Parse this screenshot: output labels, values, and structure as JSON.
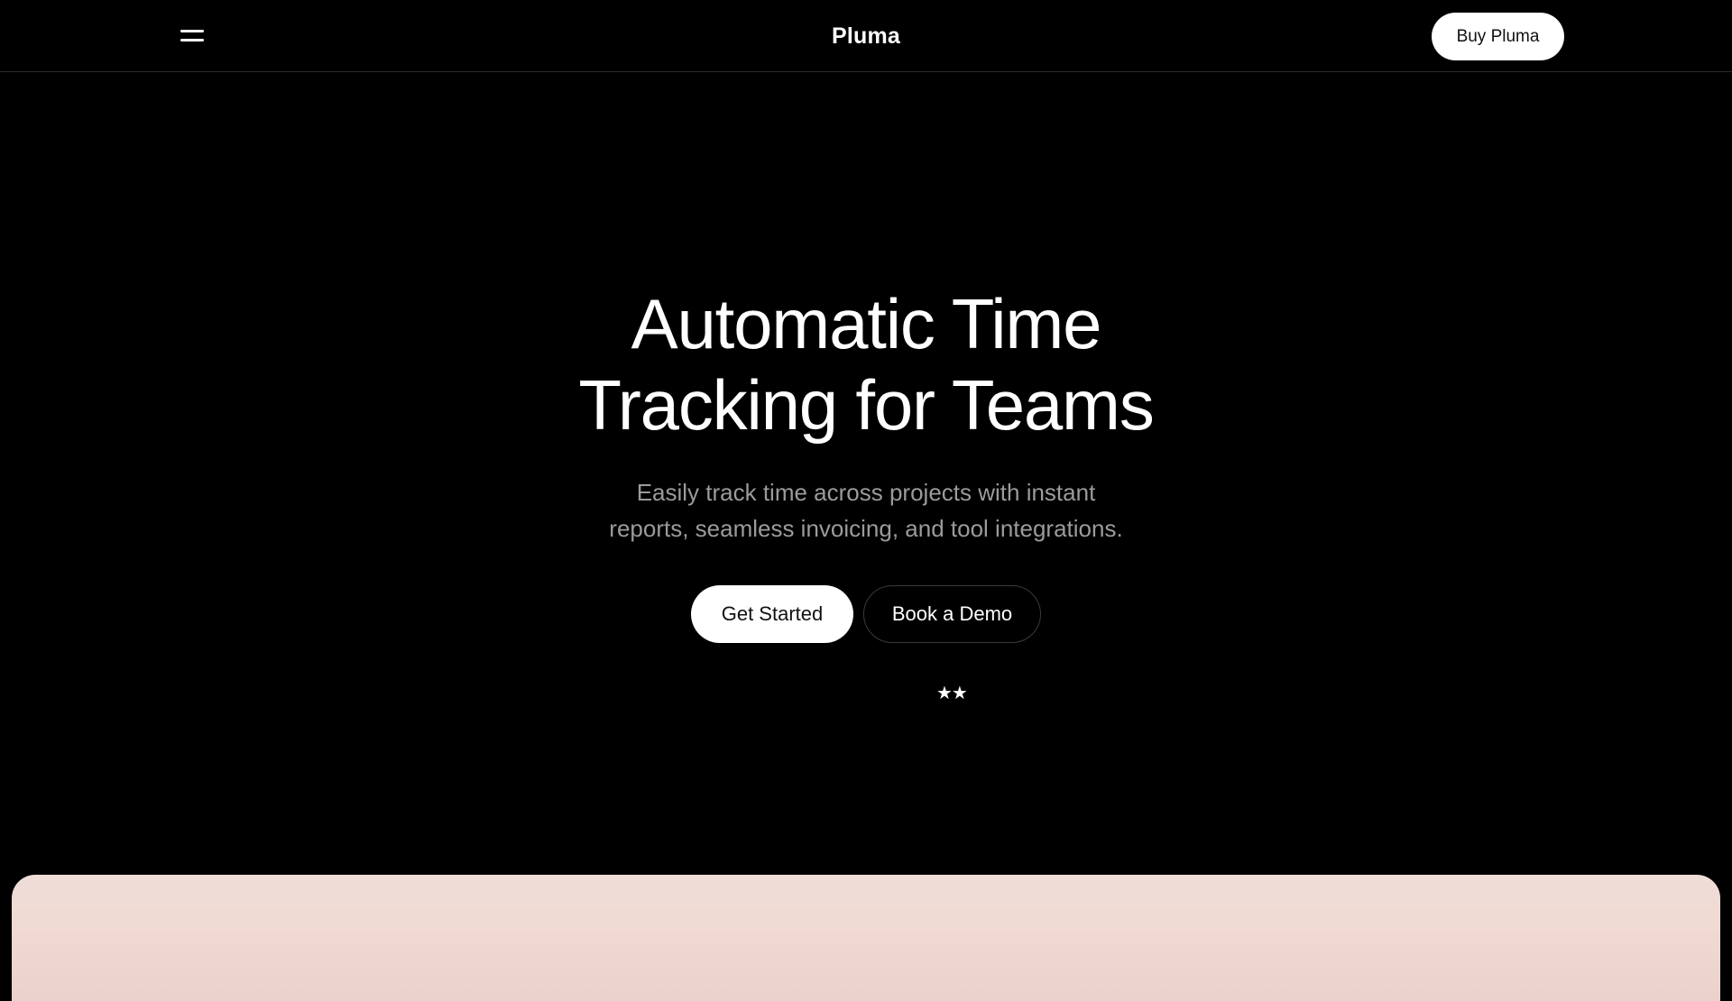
{
  "header": {
    "brand": "Pluma",
    "menu_icon": "hamburger-menu-icon",
    "buy_label": "Buy Pluma"
  },
  "hero": {
    "title_line1": "Automatic Time",
    "title_line2": "Tracking for Teams",
    "subtitle_line1": "Easily track time across projects with instant",
    "subtitle_line2": "reports, seamless invoicing, and tool integrations.",
    "primary_cta": "Get Started",
    "secondary_cta": "Book a Demo",
    "rating_stars": "★★"
  },
  "colors": {
    "background": "#000000",
    "text": "#ffffff",
    "subtitle": "#9b9b9b",
    "panel": "#efddd8"
  }
}
